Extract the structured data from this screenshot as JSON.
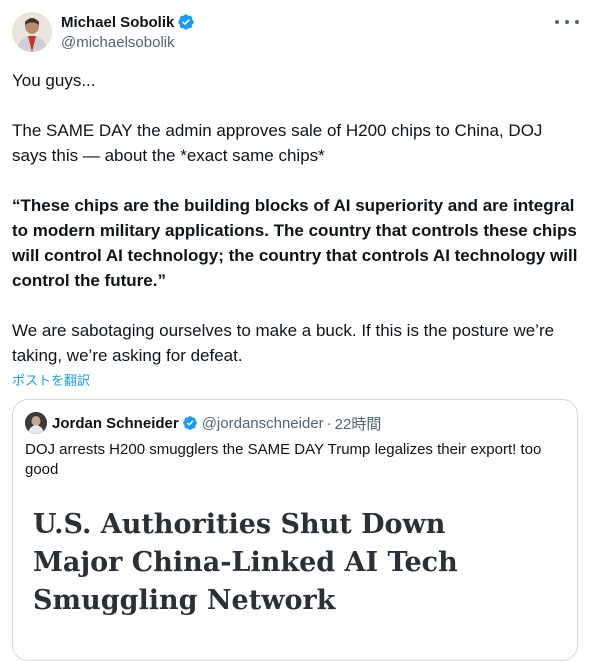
{
  "tweet": {
    "author_name": "Michael Sobolik",
    "author_handle": "@michaelsobolik",
    "paragraphs": {
      "p1": "You guys...",
      "p2": "The SAME DAY the admin approves sale of H200 chips to China, DOJ says this — about the *exact same chips*",
      "p3": "“These chips are the building blocks of AI superiority and are integral to modern military applications. The country that controls these chips will control AI technology; the country that controls AI technology will control the future.”",
      "p4": "We are sabotaging ourselves to make a buck. If this is the posture we’re taking, we’re asking for defeat."
    },
    "translate_label": "ポストを翻訳"
  },
  "quoted": {
    "author_name": "Jordan Schneider",
    "author_handle": "@jordanschneider",
    "separator": "·",
    "time": "22時間",
    "text": "DOJ arrests H200 smugglers the SAME DAY Trump legalizes their export! too good",
    "media_headline": "U.S. Authorities Shut Down Major China-Linked AI Tech Smuggling Network"
  },
  "colors": {
    "verified": "#1d9bf0",
    "link": "#1d9bf0",
    "secondary_text": "#536471",
    "border": "#cfd9de"
  }
}
